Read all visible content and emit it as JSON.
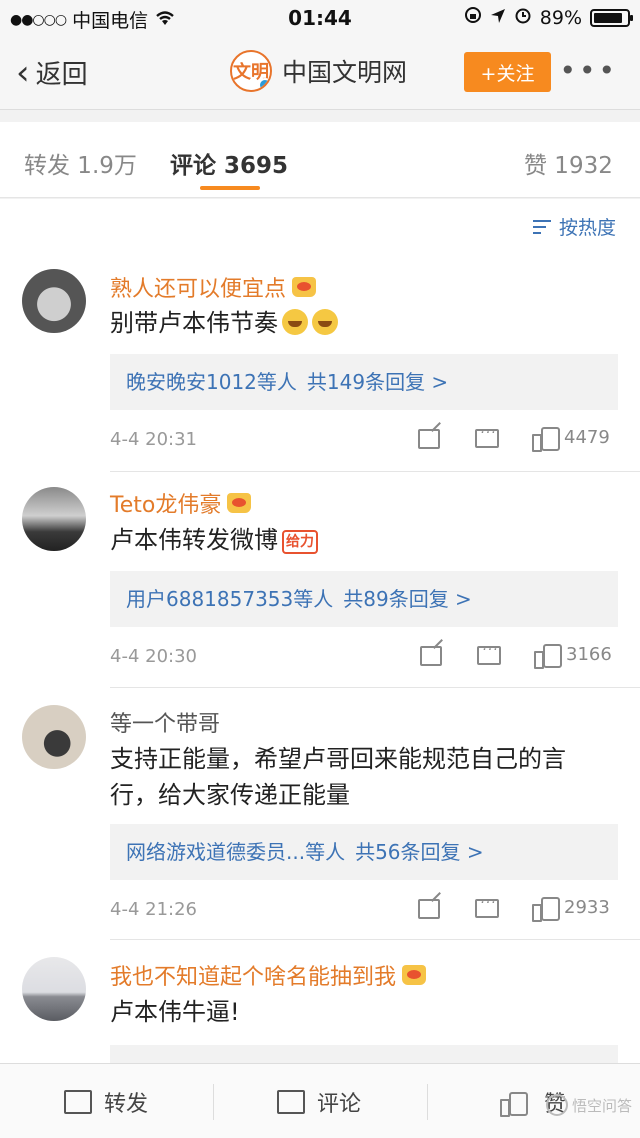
{
  "status_bar": {
    "carrier": "中国电信",
    "time": "01:44",
    "battery": "89%",
    "battery_level": 0.89
  },
  "nav": {
    "back_label": "返回",
    "title": "中国文明网",
    "logo_text": "文明",
    "follow_label": "+关注",
    "more_label": "•••"
  },
  "tabs": {
    "repost": "转发 1.9万",
    "comment": "评论 3695",
    "like": "赞 1932"
  },
  "sort_label": "按热度",
  "comments": [
    {
      "name": "熟人还可以便宜点",
      "text": "别带卢本伟节奏",
      "replies_user": "晚安晚安1012等人",
      "replies_count": "共149条回复 >",
      "time": "4-4 20:31",
      "likes": "4479"
    },
    {
      "name": "Teto龙伟豪",
      "text": "卢本伟转发微博",
      "tag": "给力",
      "replies_user": "用户6881857353等人",
      "replies_count": "共89条回复 >",
      "time": "4-4 20:30",
      "likes": "3166"
    },
    {
      "name": "等一个带哥",
      "text": "支持正能量，希望卢哥回来能规范自己的言行，给大家传递正能量",
      "replies_user": "网络游戏道德委员...等人",
      "replies_count": "共56条回复 >",
      "time": "4-4 21:26",
      "likes": "2933"
    },
    {
      "name": "我也不知道起个啥名能抽到我",
      "text": "卢本伟牛逼!"
    }
  ],
  "bottom_bar": {
    "repost": "转发",
    "comment": "评论",
    "like": "赞",
    "watermark": "悟空问答"
  },
  "colors": {
    "accent_orange": "#f78a1f",
    "username_orange": "#e37b2a",
    "link_blue": "#3d73b5"
  }
}
